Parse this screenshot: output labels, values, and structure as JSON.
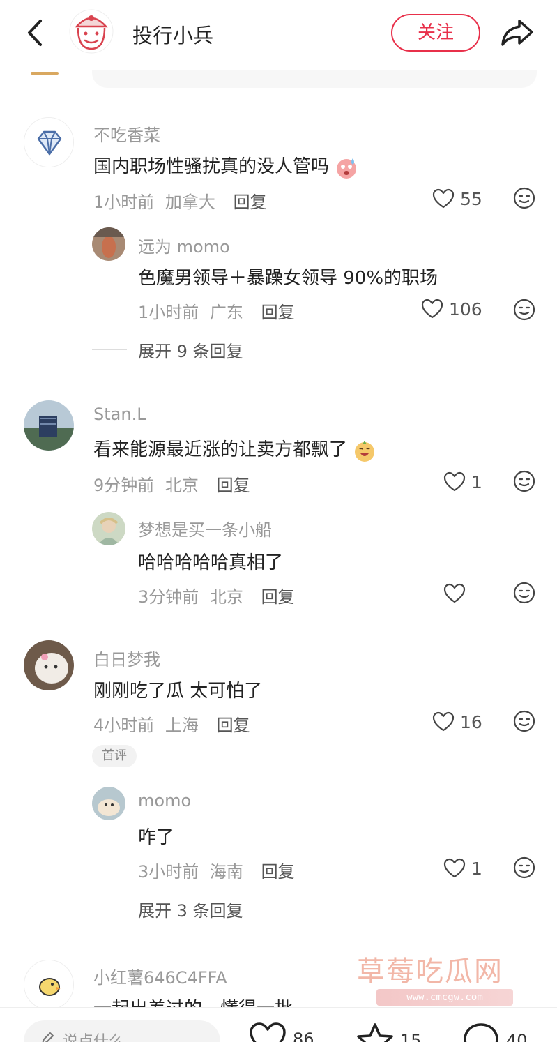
{
  "header": {
    "title": "投行小兵",
    "follow_label": "关注"
  },
  "comments": [
    {
      "user": "不吃香菜",
      "text": "国内职场性骚扰真的没人管吗",
      "time": "1小时前",
      "location": "加拿大",
      "reply_label": "回复",
      "likes": "55",
      "replies": [
        {
          "user": "远为 momo",
          "text": "色魔男领导＋暴躁女领导  90%的职场",
          "time": "1小时前",
          "location": "广东",
          "reply_label": "回复",
          "likes": "106"
        }
      ],
      "expand_label": "展开 9 条回复"
    },
    {
      "user": "Stan.L",
      "text": "看来能源最近涨的让卖方都飘了",
      "time": "9分钟前",
      "location": "北京",
      "reply_label": "回复",
      "likes": "1",
      "replies": [
        {
          "user": "梦想是买一条小船",
          "text": "哈哈哈哈哈真相了",
          "time": "3分钟前",
          "location": "北京",
          "reply_label": "回复",
          "likes": ""
        }
      ]
    },
    {
      "user": "白日梦我",
      "text": "刚刚吃了瓜 太可怕了",
      "time": "4小时前",
      "location": "上海",
      "reply_label": "回复",
      "likes": "16",
      "tag": "首评",
      "replies": [
        {
          "user": "momo",
          "text": "咋了",
          "time": "3小时前",
          "location": "海南",
          "reply_label": "回复",
          "likes": "1"
        }
      ],
      "expand_label": "展开 3 条回复"
    },
    {
      "user": "小红薯646C4FFA",
      "text": "一起出差过的，懂得一批"
    }
  ],
  "watermark": {
    "title": "草莓吃瓜网",
    "url": "www.cmcgw.com"
  },
  "bottom_bar": {
    "input_placeholder": "说点什么...",
    "like_count": "86",
    "collect_count": "15",
    "comment_count": "40"
  },
  "colors": {
    "accent": "#e8304a",
    "muted_text": "#999999",
    "body_text": "#222222"
  }
}
